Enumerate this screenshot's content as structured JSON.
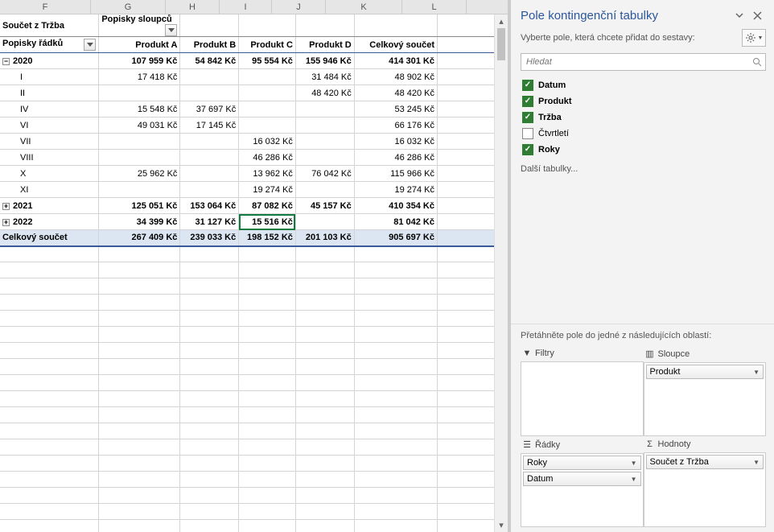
{
  "columns": [
    "F",
    "G",
    "H",
    "I",
    "J",
    "K",
    "L"
  ],
  "pivot": {
    "corner_label": "Součet z Tržba",
    "col_label": "Popisky sloupců",
    "row_label": "Popisky řádků",
    "col_headers": [
      "Produkt A",
      "Produkt B",
      "Produkt C",
      "Produkt D",
      "Celkový součet"
    ],
    "rows": [
      {
        "type": "group",
        "expand": "minus",
        "label": "2020",
        "vals": [
          "107 959 Kč",
          "54 842 Kč",
          "95 554 Kč",
          "155 946 Kč",
          "414 301 Kč"
        ]
      },
      {
        "type": "item",
        "label": "I",
        "vals": [
          "17 418 Kč",
          "",
          "",
          "31 484 Kč",
          "48 902 Kč"
        ]
      },
      {
        "type": "item",
        "label": "II",
        "vals": [
          "",
          "",
          "",
          "48 420 Kč",
          "48 420 Kč"
        ]
      },
      {
        "type": "item",
        "label": "IV",
        "vals": [
          "15 548 Kč",
          "37 697 Kč",
          "",
          "",
          "53 245 Kč"
        ]
      },
      {
        "type": "item",
        "label": "VI",
        "vals": [
          "49 031 Kč",
          "17 145 Kč",
          "",
          "",
          "66 176 Kč"
        ]
      },
      {
        "type": "item",
        "label": "VII",
        "vals": [
          "",
          "",
          "16 032 Kč",
          "",
          "16 032 Kč"
        ]
      },
      {
        "type": "item",
        "label": "VIII",
        "vals": [
          "",
          "",
          "46 286 Kč",
          "",
          "46 286 Kč"
        ]
      },
      {
        "type": "item",
        "label": "X",
        "vals": [
          "25 962 Kč",
          "",
          "13 962 Kč",
          "76 042 Kč",
          "115 966 Kč"
        ]
      },
      {
        "type": "item",
        "label": "XI",
        "vals": [
          "",
          "",
          "19 274 Kč",
          "",
          "19 274 Kč"
        ]
      },
      {
        "type": "group",
        "expand": "plus",
        "label": "2021",
        "vals": [
          "125 051 Kč",
          "153 064 Kč",
          "87 082 Kč",
          "45 157 Kč",
          "410 354 Kč"
        ]
      },
      {
        "type": "group",
        "expand": "plus",
        "label": "2022",
        "vals": [
          "34 399 Kč",
          "31 127 Kč",
          "15 516 Kč",
          "",
          "81 042 Kč"
        ],
        "selected_col": 2
      },
      {
        "type": "grand",
        "label": "Celkový součet",
        "vals": [
          "267 409 Kč",
          "239 033 Kč",
          "198 152 Kč",
          "201 103 Kč",
          "905 697 Kč"
        ]
      }
    ]
  },
  "pane": {
    "title": "Pole kontingenční tabulky",
    "subtitle": "Vyberte pole, která chcete přidat do sestavy:",
    "search_placeholder": "Hledat",
    "fields": [
      {
        "label": "Datum",
        "checked": true
      },
      {
        "label": "Produkt",
        "checked": true
      },
      {
        "label": "Tržba",
        "checked": true
      },
      {
        "label": "Čtvrtletí",
        "checked": false
      },
      {
        "label": "Roky",
        "checked": true
      }
    ],
    "more_tables": "Další tabulky...",
    "drag_label": "Přetáhněte pole do jedné z následujících oblastí:",
    "areas": {
      "filters": {
        "title": "Filtry",
        "items": []
      },
      "columns": {
        "title": "Sloupce",
        "items": [
          "Produkt"
        ]
      },
      "rows": {
        "title": "Řádky",
        "items": [
          "Roky",
          "Datum"
        ]
      },
      "values": {
        "title": "Hodnoty",
        "items": [
          "Součet z Tržba"
        ]
      }
    }
  }
}
